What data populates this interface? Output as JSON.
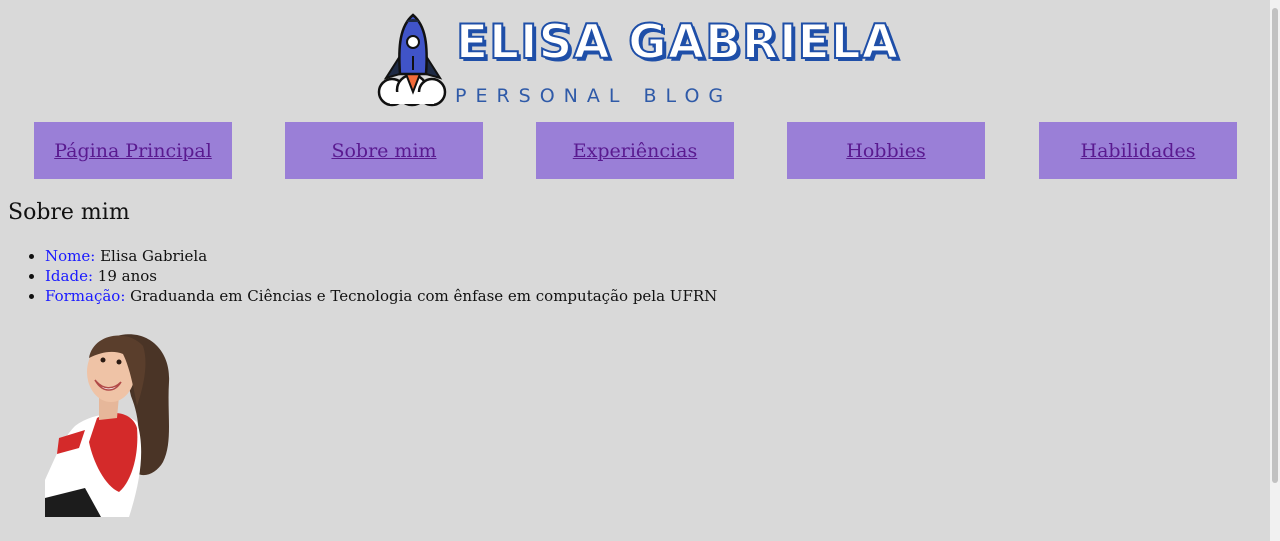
{
  "brand": {
    "title": "ELISA GABRIELA",
    "subtitle": "PERSONAL BLOG",
    "logo_icon": "rocket-icon"
  },
  "nav": {
    "items": [
      {
        "label": "Página Principal"
      },
      {
        "label": "Sobre mim"
      },
      {
        "label": "Experiências"
      },
      {
        "label": "Hobbies"
      },
      {
        "label": "Habilidades"
      }
    ]
  },
  "about": {
    "heading": "Sobre mim",
    "items": [
      {
        "key": "Nome:",
        "value": " Elisa Gabriela"
      },
      {
        "key": "Idade:",
        "value": " 19 anos"
      },
      {
        "key": "Formação:",
        "value": " Graduanda em Ciências e Tecnologia com ênfase em computação pela UFRN"
      }
    ]
  },
  "colors": {
    "background": "#d9d9d9",
    "nav_background": "#9a7fd7",
    "nav_text": "#5a1a90",
    "brand_blue": "#1f4fa8",
    "key_text": "#1a1aff"
  }
}
